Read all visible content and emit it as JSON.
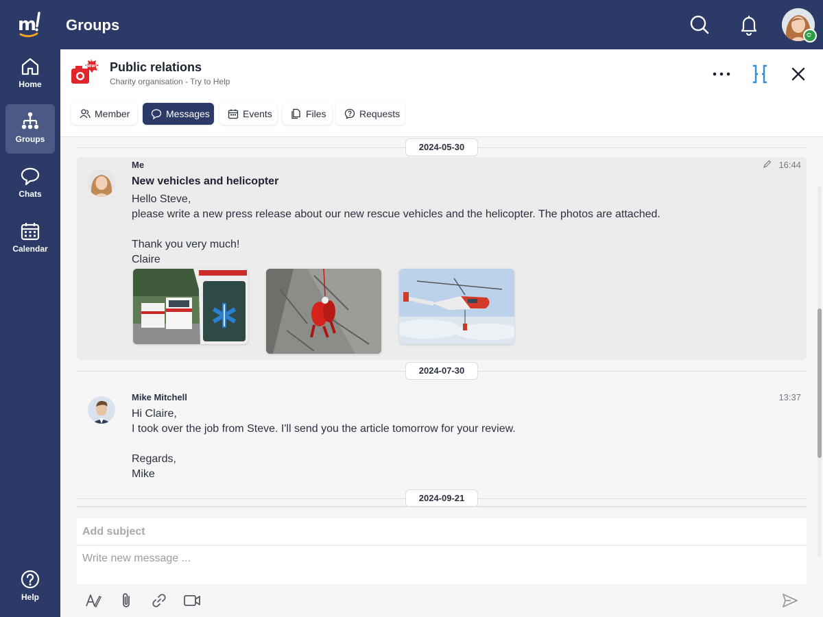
{
  "header": {
    "app_title": "Groups"
  },
  "sidebar": {
    "items": [
      {
        "label": "Home",
        "icon": "home-icon"
      },
      {
        "label": "Groups",
        "icon": "groups-icon"
      },
      {
        "label": "Chats",
        "icon": "chat-bubble-icon"
      },
      {
        "label": "Calendar",
        "icon": "calendar-icon"
      }
    ],
    "help": {
      "label": "Help",
      "icon": "help-icon"
    }
  },
  "group": {
    "title": "Public relations",
    "subtitle": "Charity organisation - Try to Help",
    "badge_text": "NEWS"
  },
  "tabs": [
    {
      "label": "Member",
      "icon": "member-icon"
    },
    {
      "label": "Messages",
      "icon": "message-icon"
    },
    {
      "label": "Events",
      "icon": "events-icon"
    },
    {
      "label": "Files",
      "icon": "files-icon"
    },
    {
      "label": "Requests",
      "icon": "requests-icon"
    }
  ],
  "messages": [
    {
      "date": "2024-05-30",
      "author": "Me",
      "time": "16:44",
      "subject": "New vehicles and helicopter",
      "lines": [
        "Hello Steve,",
        "please write a new press release about our new rescue vehicles and the helicopter. The photos are attached.",
        "",
        "Thank you very much!",
        "Claire"
      ]
    },
    {
      "date": "2024-07-30",
      "author": "Mike Mitchell",
      "time": "13:37",
      "lines": [
        "Hi Claire,",
        "I took over the job from Steve. I'll send you the article tomorrow for your review.",
        "",
        "Regards,",
        "Mike"
      ]
    }
  ],
  "next_date": "2024-09-21",
  "composer": {
    "subject_placeholder": "Add subject",
    "message_placeholder": "Write new message ..."
  },
  "colors": {
    "primary": "#2b3a66",
    "active_nav": "#4a5a85",
    "accent_blue": "#2b8fd6",
    "online_green": "#2e9e48",
    "badge_red": "#e0262c"
  }
}
